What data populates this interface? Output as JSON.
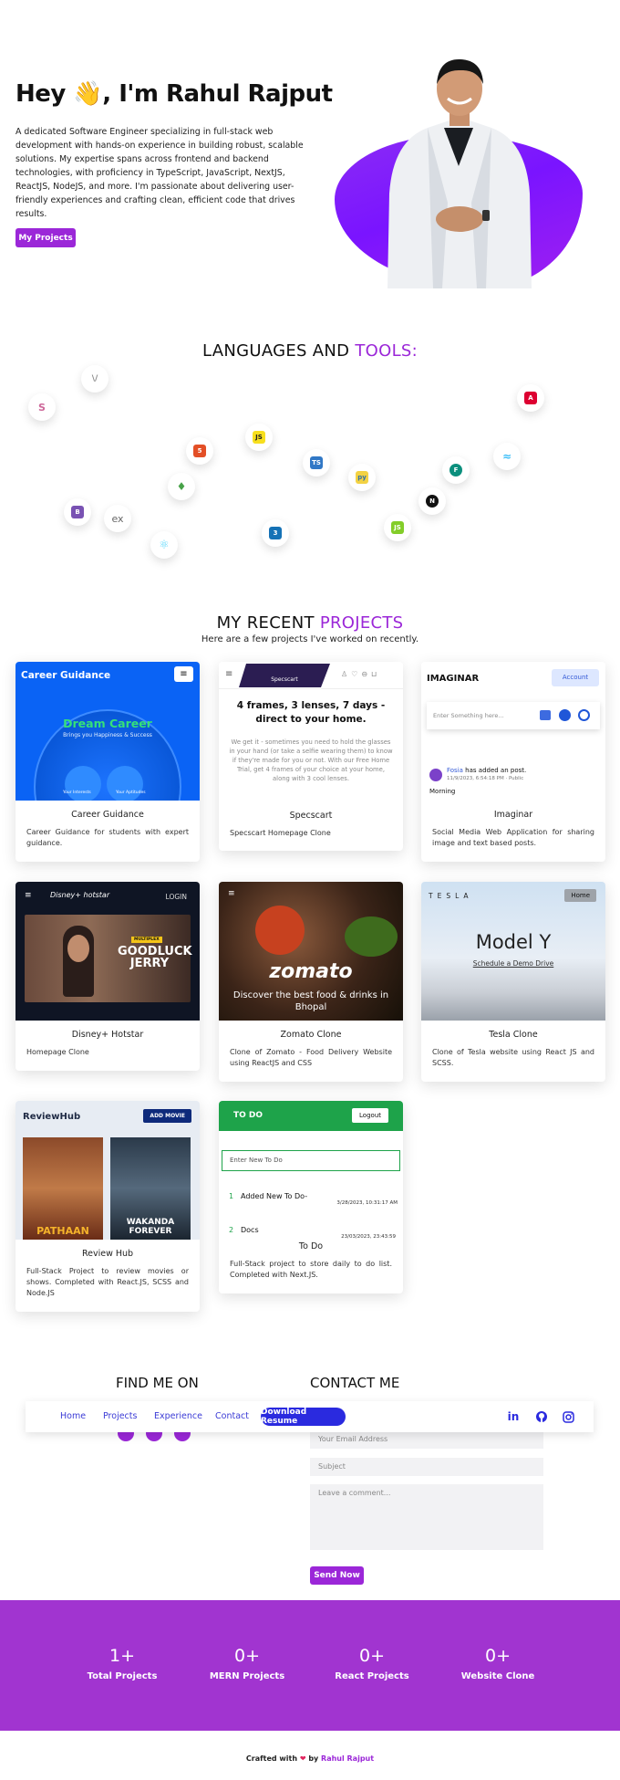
{
  "hero": {
    "greeting": "Hey",
    "wave": "👋",
    "name": ", I'm Rahul Rajput",
    "description": "A dedicated Software Engineer specializing in full-stack web development with hands-on experience in building robust, scalable solutions. My expertise spans across frontend and backend technologies, with proficiency in TypeScript, JavaScript, NextJS, ReactJS, NodeJS, and more. I'm passionate about delivering user-friendly experiences and crafting clean, efficient code that drives results.",
    "button": "My Projects"
  },
  "tools": {
    "title_a": "LANGUAGES AND ",
    "title_b": "TOOLS:",
    "items": [
      "sass-icon",
      "vim-icon",
      "angular-icon",
      "html5-icon",
      "js-icon",
      "typescript-icon",
      "python-icon",
      "flask-icon",
      "tailwind-icon",
      "mongodb-icon",
      "nextjs-icon",
      "bootstrap-icon",
      "express-icon",
      "react-icon",
      "css3-icon",
      "nodejs-icon"
    ],
    "express_label": "ex"
  },
  "projects": {
    "title_a": "MY RECENT ",
    "title_b": "PROJECTS",
    "subtitle": "Here are a few projects I've worked on recently.",
    "cards": [
      {
        "title": "Career Guidance",
        "desc": "Career Guidance for students with expert guidance.",
        "shot": {
          "brand": "Career Guidance",
          "headline": "Dream Career",
          "tag": "Brings you Happiness & Success",
          "c1": "Your Interests",
          "c2": "Your Aptitudes"
        }
      },
      {
        "title": "Specscart",
        "desc": "Specscart Homepage Clone",
        "shot": {
          "brand": "Specscart",
          "headline": "4 frames, 3 lenses, 7 days - direct to your home.",
          "body": "We get it - sometimes you need to hold the glasses in your hand (or take a selfie wearing them) to know if they're made for you or not. With our Free Home Trial, get 4 frames of your choice at your home, along with 3 cool lenses."
        }
      },
      {
        "title": "Imaginar",
        "desc": "Social Media Web Application for sharing image and text based posts.",
        "shot": {
          "brand": "IMAGINAR",
          "account": "Account",
          "placeholder": "Enter Something here...",
          "poster": "Fosia",
          "action": " has added an post.",
          "meta": "11/9/2023, 6:54:18 PM · Public",
          "post": "Morning"
        }
      },
      {
        "title": "Disney+ Hotstar",
        "desc": "Homepage Clone",
        "shot": {
          "brand": "Disney+ hotstar",
          "login": "LOGIN",
          "tag": "MULTIPLEX",
          "movie": "GOODLUCK JERRY"
        }
      },
      {
        "title": "Zomato Clone",
        "desc": "Clone of Zomato - Food Delivery Website using ReactJS and CSS",
        "shot": {
          "brand": "zomato",
          "headline": "Discover the best food & drinks in Bhopal"
        }
      },
      {
        "title": "Tesla Clone",
        "desc": "Clone of Tesla website using React JS and SCSS.",
        "shot": {
          "brand": "TESLA",
          "home": "Home",
          "model": "Model Y",
          "cta": "Schedule a Demo Drive"
        }
      },
      {
        "title": "Review Hub",
        "desc": "Full-Stack Project to review movies or shows. Completed with React.JS, SCSS and Node.JS",
        "shot": {
          "brand": "ReviewHub",
          "add": "ADD MOVIE",
          "m1": "PATHAAN",
          "m2": "WAKANDA FOREVER"
        }
      },
      {
        "title": "To Do",
        "desc": "Full-Stack project to store daily to do list. Completed with Next.JS.",
        "shot": {
          "brand": "TO DO",
          "logout": "Logout",
          "placeholder": "Enter New To Do",
          "i1n": "1",
          "i1": "Added New To Do-",
          "i1d": "3/28/2023, 10:31:17 AM",
          "i2n": "2",
          "i2": "Docs",
          "i2d": "23/03/2023, 23:43:59"
        }
      }
    ]
  },
  "find": {
    "title": "FIND ME ON"
  },
  "contact": {
    "title": "CONTACT ME",
    "email_ph": "Your Email Address",
    "subject_ph": "Subject",
    "comment_ph": "Leave a comment...",
    "send": "Send Now"
  },
  "nav": {
    "home": "Home",
    "projects": "Projects",
    "experience": "Experience",
    "contact": "Contact",
    "resume": "Download Resume",
    "linkedin": "in"
  },
  "stats": [
    {
      "n": "1+",
      "l": "Total Projects"
    },
    {
      "n": "0+",
      "l": "MERN Projects"
    },
    {
      "n": "0+",
      "l": "React Projects"
    },
    {
      "n": "0+",
      "l": "Website Clone"
    }
  ],
  "footer": {
    "a": "Crafted with ",
    "heart": "❤",
    "b": " by ",
    "name": "Rahul Rajput"
  },
  "colors": {
    "accent": "#9b27d8",
    "nav_blue": "#2a2adf",
    "stats_bg": "#a134d0"
  }
}
